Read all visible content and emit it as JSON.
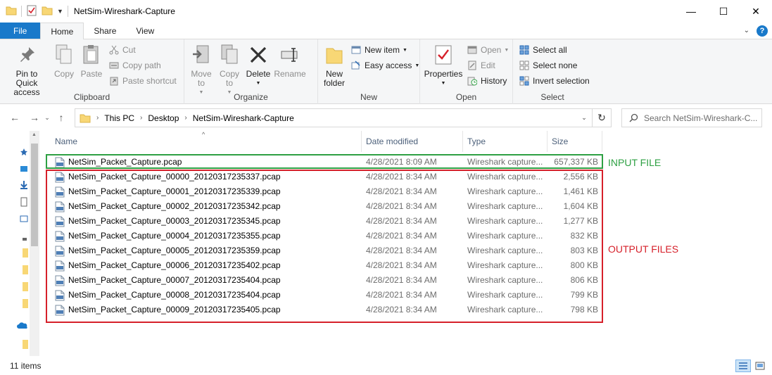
{
  "window": {
    "title": "NetSim-Wireshark-Capture",
    "minimize_glyph": "—",
    "maximize_glyph": "☐",
    "close_glyph": "✕"
  },
  "tabs": [
    {
      "label": "File"
    },
    {
      "label": "Home"
    },
    {
      "label": "Share"
    },
    {
      "label": "View"
    }
  ],
  "ribbon": {
    "clipboard": {
      "label": "Clipboard",
      "pin": "Pin to Quick access",
      "copy": "Copy",
      "paste": "Paste",
      "cut": "Cut",
      "copy_path": "Copy path",
      "paste_shortcut": "Paste shortcut"
    },
    "organize": {
      "label": "Organize",
      "move_to": "Move to",
      "copy_to": "Copy to",
      "delete": "Delete",
      "rename": "Rename"
    },
    "new": {
      "label": "New",
      "new_folder": "New folder",
      "new_item": "New item",
      "easy_access": "Easy access"
    },
    "open": {
      "label": "Open",
      "properties": "Properties",
      "open": "Open",
      "edit": "Edit",
      "history": "History"
    },
    "select": {
      "label": "Select",
      "select_all": "Select all",
      "select_none": "Select none",
      "invert": "Invert selection"
    }
  },
  "address": {
    "crumbs": [
      "This PC",
      "Desktop",
      "NetSim-Wireshark-Capture"
    ],
    "search_placeholder": "Search NetSim-Wireshark-C..."
  },
  "columns": {
    "name": "Name",
    "date": "Date modified",
    "type": "Type",
    "size": "Size"
  },
  "files": [
    {
      "name": "NetSim_Packet_Capture.pcap",
      "date": "4/28/2021 8:09 AM",
      "type": "Wireshark capture...",
      "size": "657,337 KB"
    },
    {
      "name": "NetSim_Packet_Capture_00000_20120317235337.pcap",
      "date": "4/28/2021 8:34 AM",
      "type": "Wireshark capture...",
      "size": "2,556 KB"
    },
    {
      "name": "NetSim_Packet_Capture_00001_20120317235339.pcap",
      "date": "4/28/2021 8:34 AM",
      "type": "Wireshark capture...",
      "size": "1,461 KB"
    },
    {
      "name": "NetSim_Packet_Capture_00002_20120317235342.pcap",
      "date": "4/28/2021 8:34 AM",
      "type": "Wireshark capture...",
      "size": "1,604 KB"
    },
    {
      "name": "NetSim_Packet_Capture_00003_20120317235345.pcap",
      "date": "4/28/2021 8:34 AM",
      "type": "Wireshark capture...",
      "size": "1,277 KB"
    },
    {
      "name": "NetSim_Packet_Capture_00004_20120317235355.pcap",
      "date": "4/28/2021 8:34 AM",
      "type": "Wireshark capture...",
      "size": "832 KB"
    },
    {
      "name": "NetSim_Packet_Capture_00005_20120317235359.pcap",
      "date": "4/28/2021 8:34 AM",
      "type": "Wireshark capture...",
      "size": "803 KB"
    },
    {
      "name": "NetSim_Packet_Capture_00006_20120317235402.pcap",
      "date": "4/28/2021 8:34 AM",
      "type": "Wireshark capture...",
      "size": "800 KB"
    },
    {
      "name": "NetSim_Packet_Capture_00007_20120317235404.pcap",
      "date": "4/28/2021 8:34 AM",
      "type": "Wireshark capture...",
      "size": "806 KB"
    },
    {
      "name": "NetSim_Packet_Capture_00008_20120317235404.pcap",
      "date": "4/28/2021 8:34 AM",
      "type": "Wireshark capture...",
      "size": "799 KB"
    },
    {
      "name": "NetSim_Packet_Capture_00009_20120317235405.pcap",
      "date": "4/28/2021 8:34 AM",
      "type": "Wireshark capture...",
      "size": "798 KB"
    }
  ],
  "annotations": {
    "input_label": "INPUT FILE",
    "output_label": "OUTPUT FILES",
    "input_color": "#2ea043",
    "output_color": "#d6202a"
  },
  "status": {
    "count": "11 items"
  },
  "icon_names": [
    "folder-icon",
    "properties-icon",
    "pin-icon",
    "copy-icon",
    "paste-icon",
    "scissors-icon",
    "delete-icon",
    "rename-icon",
    "pcap-file-icon",
    "refresh-icon",
    "search-icon",
    "help-icon"
  ]
}
